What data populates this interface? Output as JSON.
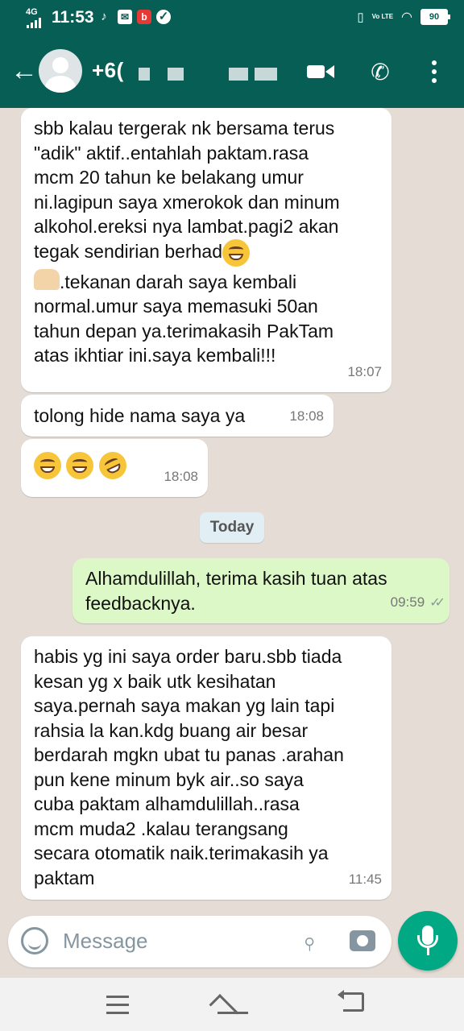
{
  "status_bar": {
    "network": "4G",
    "time": "11:53",
    "volte": "Vo LTE",
    "battery": "90"
  },
  "header": {
    "contact_name": "+6(",
    "icons": [
      "back-arrow-icon",
      "avatar",
      "video-call-icon",
      "voice-call-icon",
      "more-options-icon"
    ]
  },
  "messages": [
    {
      "direction": "incoming",
      "text_part1": "sbb kalau tergerak nk bersama terus\n\"adik\" aktif..entahlah paktam.rasa\nmcm 20 tahun ke belakang umur\nni.lagipun saya xmerokok dan minum\nalkohol.ereksi nya lambat.pagi2 akan\ntegak sendirian berhad",
      "text_part2": ".tekanan darah saya kembali\nnormal.umur saya memasuki 50an\ntahun depan ya.terimakasih PakTam\natas ikhtiar ini.saya kembali!!!",
      "time": "18:07"
    },
    {
      "direction": "incoming",
      "text": "tolong hide nama saya ya",
      "time": "18:08"
    },
    {
      "direction": "incoming",
      "emojis": [
        "grinning-face",
        "grinning-face",
        "rolling-laughing-face"
      ],
      "time": "18:08"
    },
    {
      "direction": "outgoing",
      "text": "Alhamdulillah, terima kasih tuan atas\nfeedbacknya.",
      "time": "09:59",
      "status": "read"
    },
    {
      "direction": "incoming",
      "text": "habis yg ini saya order baru.sbb tiada\nkesan yg x baik utk kesihatan\nsaya.pernah saya makan yg lain tapi\nrahsia la kan.kdg buang air besar\nberdarah mgkn ubat tu panas .arahan\npun kene minum byk air..so saya\ncuba paktam alhamdulillah..rasa\nmcm muda2 .kalau terangsang\nsecara otomatik naik.terimakasih ya\npaktam",
      "time": "11:45"
    }
  ],
  "date_divider": "Today",
  "composer": {
    "placeholder": "Message"
  },
  "colors": {
    "header": "#075e54",
    "chat_background": "#e5ddd5",
    "incoming_bubble": "#ffffff",
    "outgoing_bubble": "#dcf8c6",
    "mic_button": "#00a884"
  }
}
